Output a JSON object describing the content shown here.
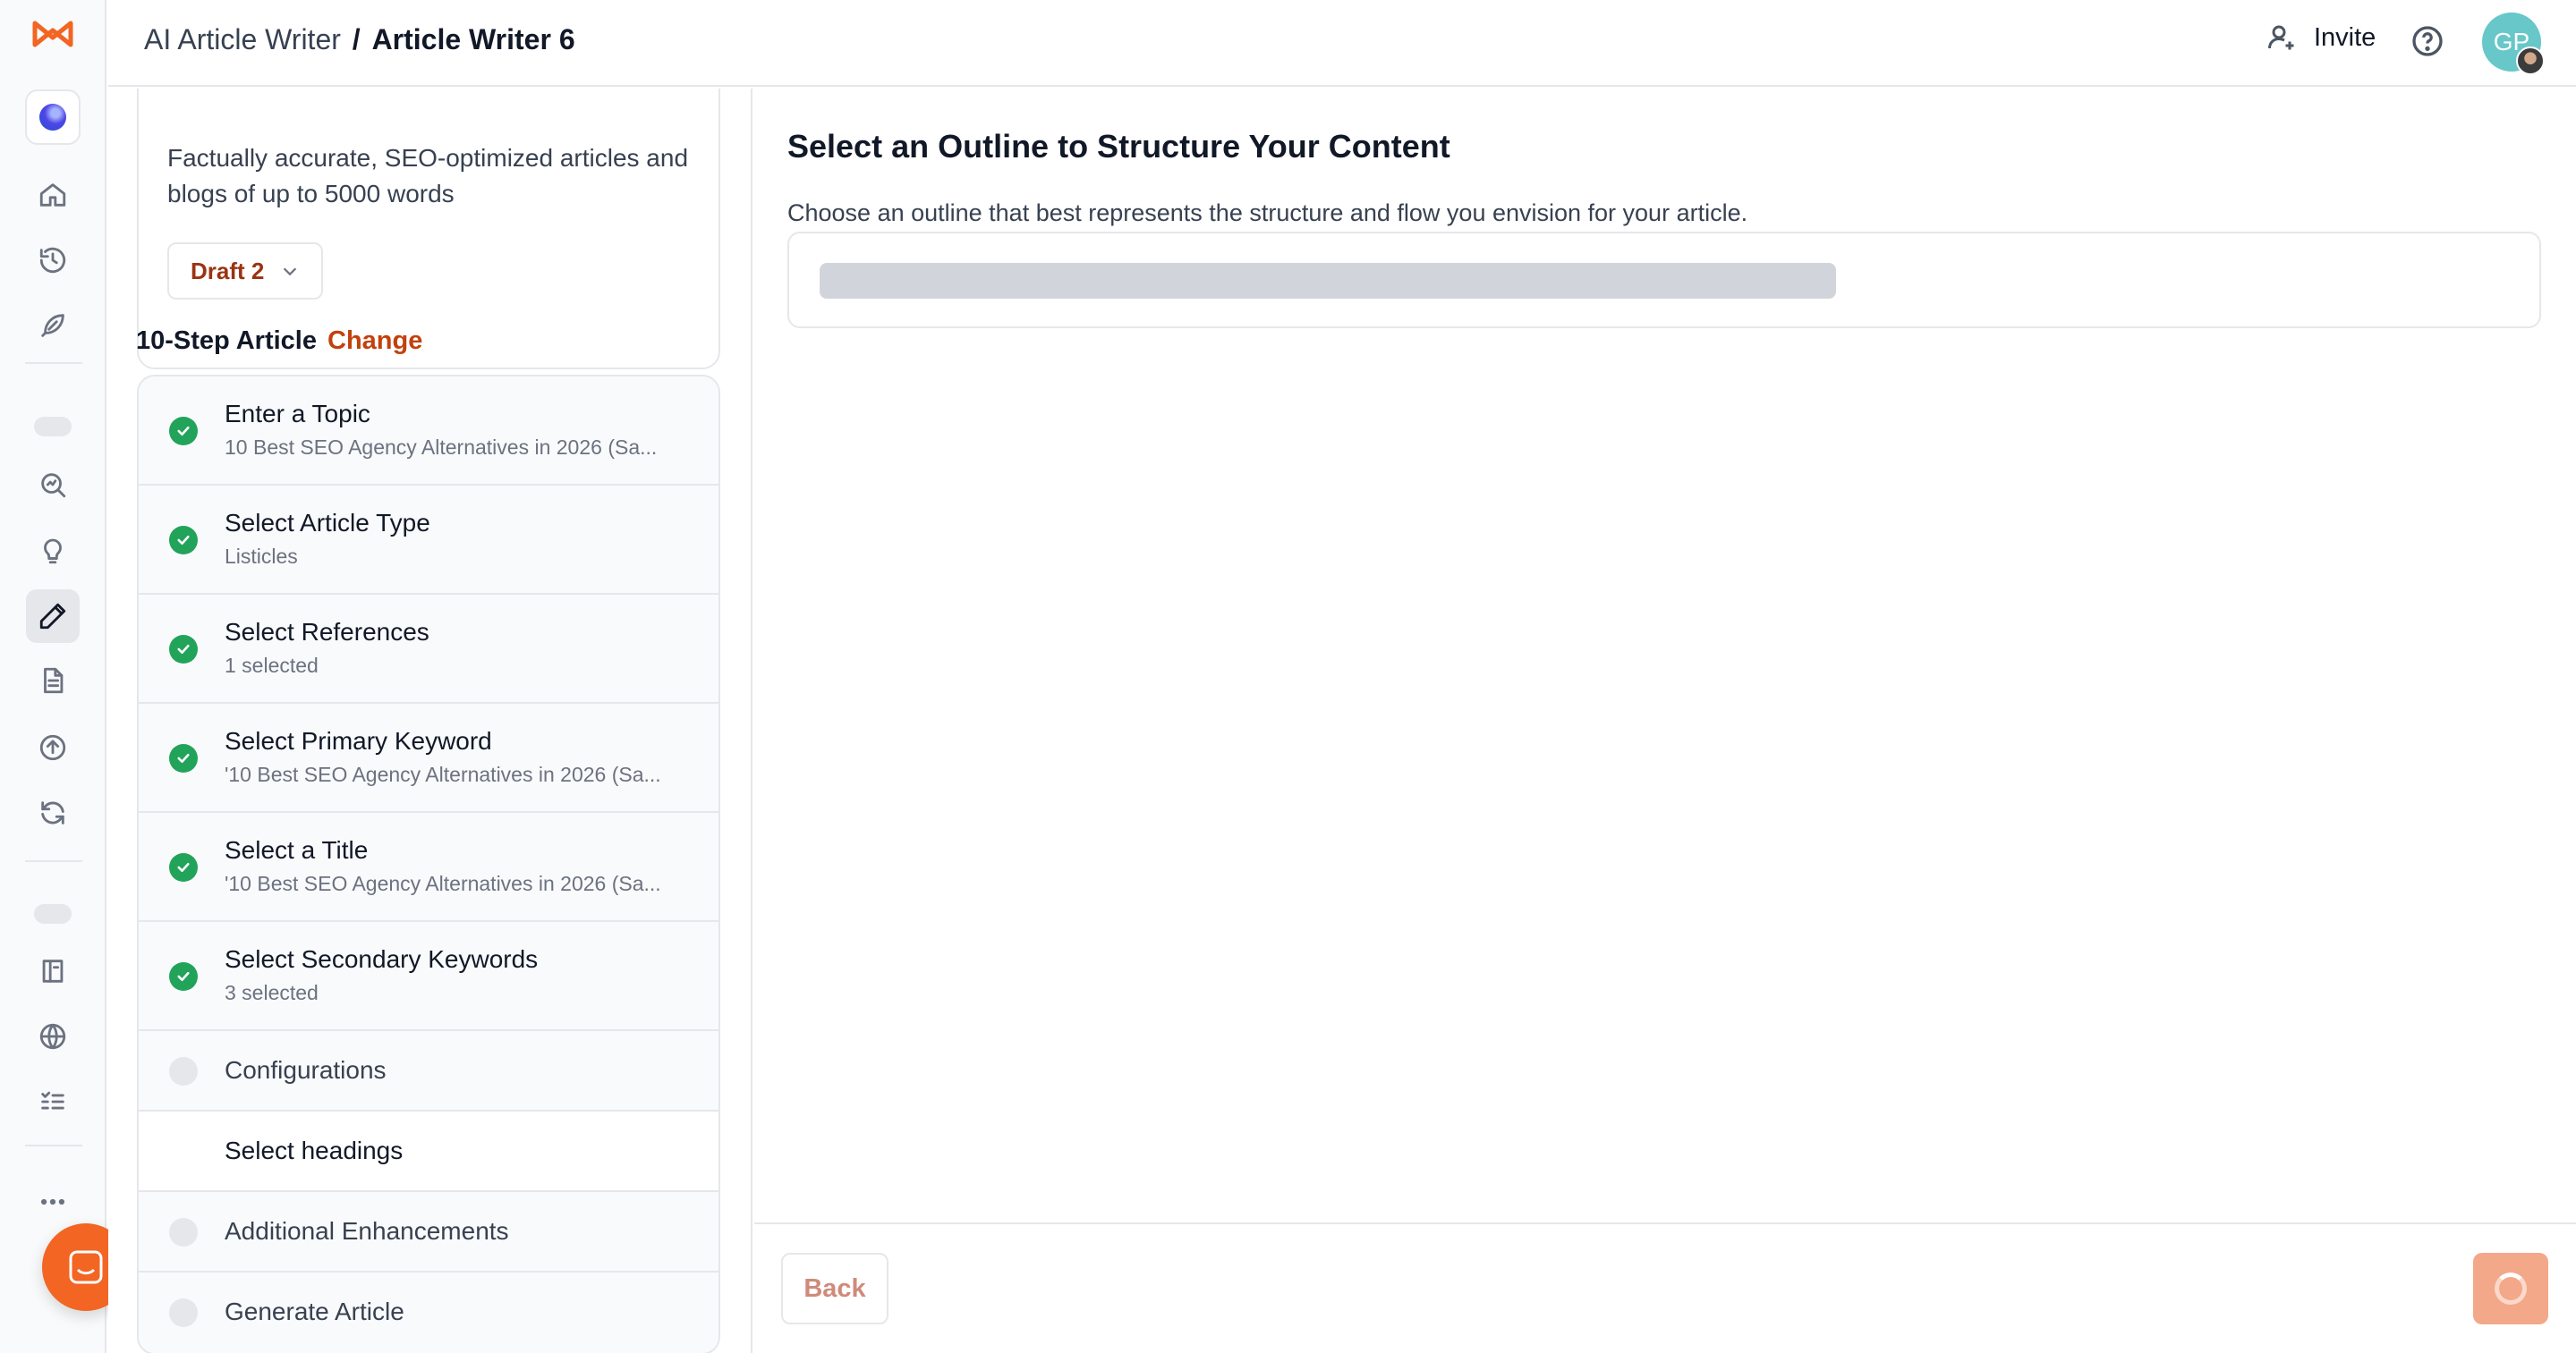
{
  "header": {
    "breadcrumb_parent": "AI Article Writer",
    "breadcrumb_separator": "/",
    "breadcrumb_current": "Article Writer 6",
    "invite_label": "Invite",
    "avatar_initials": "GP"
  },
  "sidebar": {
    "icons": [
      "home-icon",
      "history-icon",
      "feather-icon",
      "search-analytics-icon",
      "lightbulb-icon",
      "pencil-icon",
      "document-icon",
      "upload-circle-icon",
      "refresh-icon",
      "book-icon",
      "globe-icon",
      "checklist-icon",
      "more-icon"
    ],
    "active": "pencil-icon"
  },
  "article_card": {
    "description": "Factually accurate, SEO-optimized articles and blogs of up to 5000 words",
    "draft_label": "Draft 2"
  },
  "steps": {
    "title": "10-Step Article",
    "change_label": "Change",
    "items": [
      {
        "label": "Enter a Topic",
        "sub": "10 Best SEO Agency Alternatives in 2026 (Sa...",
        "status": "done"
      },
      {
        "label": "Select Article Type",
        "sub": "Listicles",
        "status": "done"
      },
      {
        "label": "Select References",
        "sub": "1 selected",
        "status": "done"
      },
      {
        "label": "Select Primary Keyword",
        "sub": "'10 Best SEO Agency Alternatives in 2026 (Sa...",
        "status": "done"
      },
      {
        "label": "Select a Title",
        "sub": "'10 Best SEO Agency Alternatives in 2026 (Sa...",
        "status": "done"
      },
      {
        "label": "Select Secondary Keywords",
        "sub": "3 selected",
        "status": "done"
      },
      {
        "label": "Configurations",
        "status": "pending"
      },
      {
        "label": "Select headings",
        "status": "current"
      },
      {
        "label": "Additional Enhancements",
        "status": "pending"
      },
      {
        "label": "Generate Article",
        "status": "pending"
      }
    ]
  },
  "main": {
    "title": "Select an Outline to Structure Your Content",
    "subtitle": "Choose an outline that best represents the structure and flow you envision for your article.",
    "back_label": "Back"
  },
  "colors": {
    "brand": "#f26522",
    "accent_text": "#c2410c",
    "success": "#22a35a"
  }
}
